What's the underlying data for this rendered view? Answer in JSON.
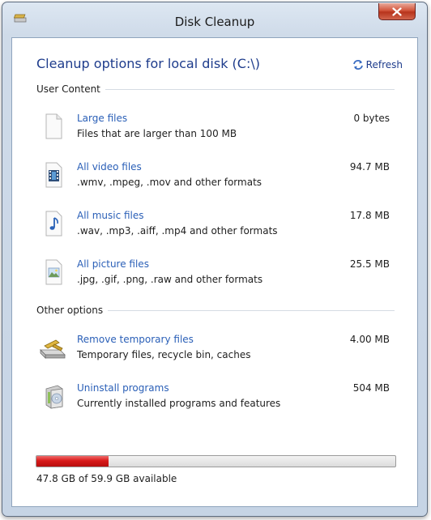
{
  "window": {
    "title": "Disk Cleanup"
  },
  "header": {
    "heading": "Cleanup options for local disk (C:\\)",
    "refresh_label": "Refresh"
  },
  "sections": {
    "user_content": "User Content",
    "other_options": "Other options"
  },
  "items": [
    {
      "name": "Large files",
      "desc": "Files that are larger than 100 MB",
      "size": "0 bytes",
      "icon": "blank-document-icon"
    },
    {
      "name": "All video files",
      "desc": ".wmv, .mpeg, .mov and other formats",
      "size": "94.7 MB",
      "icon": "video-file-icon"
    },
    {
      "name": "All music files",
      "desc": ".wav, .mp3, .aiff, .mp4 and other formats",
      "size": "17.8 MB",
      "icon": "music-file-icon"
    },
    {
      "name": "All picture files",
      "desc": ".jpg, .gif, .png, .raw and other formats",
      "size": "25.5 MB",
      "icon": "picture-file-icon"
    },
    {
      "name": "Remove temporary files",
      "desc": "Temporary files, recycle bin, caches",
      "size": "4.00 MB",
      "icon": "disk-cleanup-icon"
    },
    {
      "name": "Uninstall programs",
      "desc": "Currently installed programs and features",
      "size": "504 MB",
      "icon": "programs-installer-icon"
    }
  ],
  "disk": {
    "used_fraction": 0.202,
    "available_text": "47.8 GB of 59.9 GB available"
  },
  "colors": {
    "link": "#2a5fb7",
    "heading": "#1e3c8c",
    "bar_fill": "#d81a1a"
  }
}
